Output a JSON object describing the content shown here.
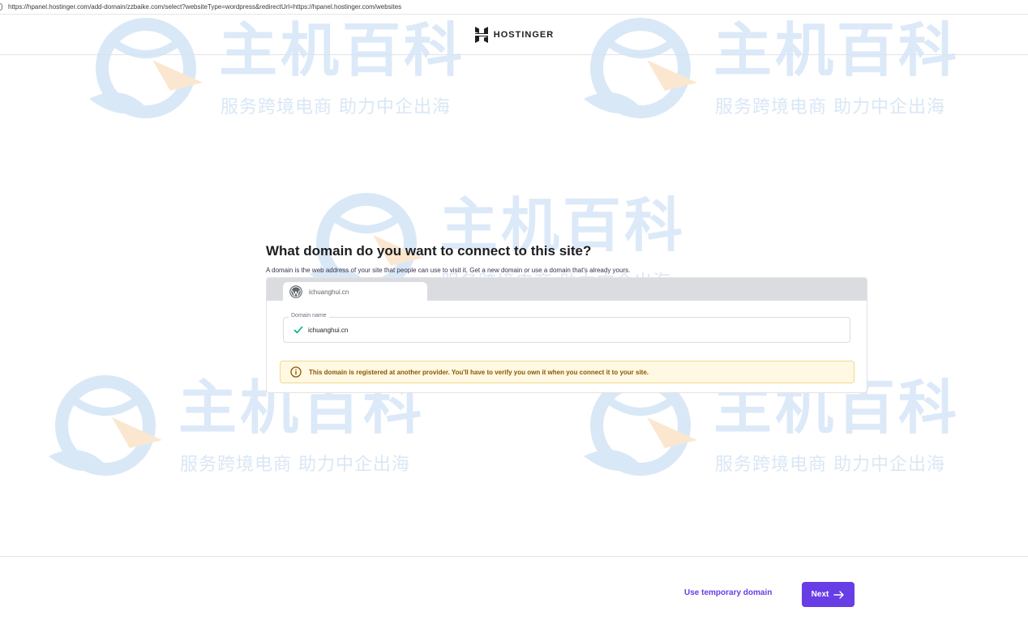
{
  "browser": {
    "url": "https://hpanel.hostinger.com/add-domain/zzbaike.com/select?websiteType=wordpress&redirectUrl=https://hpanel.hostinger.com/websites"
  },
  "header": {
    "brand_name": "HOSTINGER",
    "logo_icon": "hostinger-logo-icon"
  },
  "watermark": {
    "title": "主机百科",
    "subtitle": "服务跨境电商 助力中企出海"
  },
  "main": {
    "heading": "What domain do you want to connect to this site?",
    "description": "A domain is the web address of your site that people can use to visit it. Get a new domain or use a domain that's already yours.",
    "tab": {
      "label": "ichuanghui.cn",
      "icon": "wordpress-icon"
    },
    "domain_field": {
      "legend": "Domain name",
      "value": "ichuanghui.cn",
      "status_icon": "check-icon"
    },
    "alert": {
      "text": "This domain is registered at another provider. You'll have to verify you own it when you connect it to your site.",
      "icon": "info-icon"
    }
  },
  "footer": {
    "temporary_label": "Use temporary domain",
    "next_label": "Next"
  },
  "colors": {
    "primary": "#673de6",
    "success": "#00b090",
    "alert_bg": "#fff8e2",
    "alert_text": "#8a5700"
  }
}
